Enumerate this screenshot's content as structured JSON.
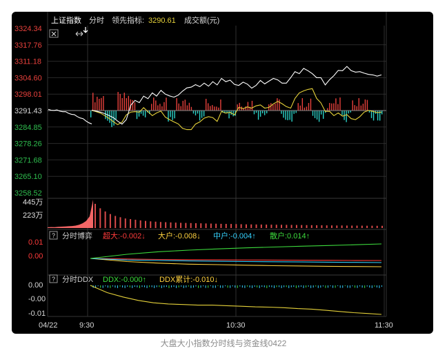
{
  "header": {
    "index_name": "上证指数",
    "mode": "分时",
    "leading_label": "领先指标:",
    "leading_value": "3290.61",
    "volume_label": "成交额(元)"
  },
  "price_axis": {
    "labels": [
      "3324.34",
      "3317.76",
      "3311.18",
      "3304.60",
      "3298.01",
      "3291.43",
      "3284.85",
      "3278.26",
      "3271.68",
      "3265.10",
      "3258.52"
    ],
    "colors": [
      "#e8413c",
      "#e8413c",
      "#e8413c",
      "#e8413c",
      "#e8413c",
      "#d8d8d8",
      "#2fbf4f",
      "#2fbf4f",
      "#2fbf4f",
      "#2fbf4f",
      "#2fbf4f"
    ]
  },
  "volume_axis": {
    "labels": [
      "445万",
      "223万"
    ]
  },
  "boyi_panel": {
    "help_icon": "?",
    "title": "分时博弈",
    "items": [
      {
        "label": "超大:-0.002↓",
        "color": "#ff3b3b"
      },
      {
        "label": "大户:-0.008↓",
        "color": "#ffd23f"
      },
      {
        "label": "中户:-0.004↑",
        "color": "#35d3ff"
      },
      {
        "label": "散户:0.014↑",
        "color": "#3ddc3d"
      }
    ],
    "axis": [
      {
        "label": "0.01",
        "color": "#ff3b3b"
      },
      {
        "label": "0.00",
        "color": "#ff3b3b"
      }
    ]
  },
  "ddx_panel": {
    "help_icon": "?",
    "title": "分时DDX",
    "items": [
      {
        "label": "DDX:-0.000↑",
        "color": "#3ddc3d"
      },
      {
        "label": "DDX累计:-0.010↓",
        "color": "#ffd23f"
      }
    ],
    "axis": [
      "0.00",
      "-0.00",
      "-0.01"
    ]
  },
  "time_axis": [
    "04/22",
    "9:30",
    "10:30",
    "11:30"
  ],
  "caption": "大盘大小指数分时线与资金线0422",
  "colors": {
    "price_line": "#ffffff",
    "leading_line": "#e6d23a",
    "up_bar": "#e8413c",
    "down_bar": "#2bd3c9",
    "volume_fill": "#ff6b6b",
    "volume_bar": "#d94a4a",
    "grid": "#2a2a2a"
  },
  "icons": {
    "close": "close-icon",
    "expand": "expand-arrows-icon",
    "cursor": "cursor-icon"
  },
  "chart_data": {
    "type": "line",
    "x_ticks": [
      "9:30",
      "10:30",
      "11:30"
    ],
    "ylim": [
      3258.52,
      3324.34
    ],
    "previous_close": 3291.43,
    "series": [
      {
        "values": [
          3291.6,
          3291.2,
          3290.8,
          3290.2,
          3289.4,
          3288.6,
          3287.2,
          3286.0,
          3287.8,
          3293.5,
          3295.5,
          3294.6,
          3297.2,
          3296.2,
          3298.5,
          3297.2,
          3299.5,
          3298.0,
          3297.3,
          3296.8,
          3297.6,
          3299.2,
          3300.5,
          3300.8,
          3301.8,
          3301.0,
          3302.4,
          3301.2,
          3303.0,
          3301.7,
          3304.3,
          3303.0,
          3303.6,
          3301.9,
          3301.5,
          3302.8,
          3302.0,
          3300.4,
          3301.5,
          3303.5,
          3302.1,
          3303.2,
          3304.3,
          3303.7,
          3302.4,
          3302.4,
          3304.6,
          3307.0,
          3306.2,
          3308.3,
          3307.4,
          3306.2,
          3304.6,
          3304.6,
          3301.7,
          3303.8,
          3305.4,
          3307.5,
          3307.4,
          3309.1,
          3307.4,
          3306.8,
          3307.0,
          3306.4,
          3305.9,
          3305.7,
          3305.2,
          3305.7
        ]
      },
      {
        "values": [
          3291.5,
          3291.0,
          3290.4,
          3289.4,
          3288.3,
          3287.0,
          3285.8,
          3286.8,
          3289.7,
          3290.8,
          3291.0,
          3290.8,
          3292.6,
          3291.0,
          3289.4,
          3290.5,
          3291.2,
          3288.8,
          3287.8,
          3286.9,
          3286.1,
          3284.3,
          3283.8,
          3283.8,
          3286.0,
          3286.9,
          3288.4,
          3289.0,
          3288.6,
          3287.1,
          3291.1,
          3290.4,
          3290.7,
          3289.7,
          3292.7,
          3292.2,
          3292.9,
          3292.4,
          3293.3,
          3293.7,
          3292.4,
          3292.7,
          3294.1,
          3295.1,
          3294.2,
          3293.0,
          3292.4,
          3296.3,
          3298.5,
          3299.3,
          3299.9,
          3300.2,
          3296.3,
          3294.5,
          3291.1,
          3291.1,
          3289.4,
          3290.5,
          3289.2,
          3289.8,
          3288.2,
          3287.8,
          3289.0,
          3290.8,
          3291.5,
          3291.1,
          3290.6,
          3290.8
        ]
      }
    ],
    "volume_series": {
      "unit": "万",
      "ylim": [
        0,
        445
      ],
      "values": [
        12,
        15,
        14,
        18,
        22,
        25,
        28,
        32,
        38,
        52,
        75,
        110,
        182,
        445,
        380,
        310,
        260,
        220,
        190,
        170,
        150,
        140,
        130,
        120,
        112,
        105,
        100,
        95,
        92,
        88,
        85,
        82,
        80,
        78,
        76,
        74,
        72,
        70,
        68,
        66,
        65,
        64,
        62,
        60,
        58,
        57,
        56,
        55,
        54,
        53,
        52,
        51,
        50,
        49,
        48,
        47,
        46,
        45,
        44,
        43,
        42,
        41,
        40,
        40,
        39,
        38,
        38,
        37,
        36,
        36,
        35,
        35
      ]
    },
    "boyi_series": [
      {
        "name": "超大",
        "values": [
          0.0,
          -0.0005,
          -0.001,
          -0.0012,
          -0.0014,
          -0.0015,
          -0.0016,
          -0.0017,
          -0.0018,
          -0.0019,
          -0.002
        ]
      },
      {
        "name": "大户",
        "values": [
          0.0,
          -0.003,
          -0.0045,
          -0.0055,
          -0.006,
          -0.0065,
          -0.007,
          -0.0073,
          -0.0076,
          -0.0078,
          -0.008
        ]
      },
      {
        "name": "中户",
        "values": [
          0.0,
          -0.0015,
          -0.002,
          -0.0024,
          -0.0027,
          -0.003,
          -0.0032,
          -0.0034,
          -0.0036,
          -0.0038,
          -0.004
        ]
      },
      {
        "name": "散户",
        "values": [
          0.0,
          0.004,
          0.0065,
          0.008,
          0.0092,
          0.0102,
          0.011,
          0.0118,
          0.0125,
          0.0132,
          0.014
        ]
      }
    ],
    "ddx_series": [
      {
        "name": "DDX累计",
        "values": [
          0.0,
          -0.0025,
          -0.004,
          -0.0052,
          -0.006,
          -0.0064,
          -0.0066,
          -0.0068,
          -0.0068,
          -0.007,
          -0.0072,
          -0.0074,
          -0.0075,
          -0.0077,
          -0.008,
          -0.0082,
          -0.0086,
          -0.009,
          -0.0094,
          -0.0097,
          -0.01
        ]
      }
    ]
  }
}
